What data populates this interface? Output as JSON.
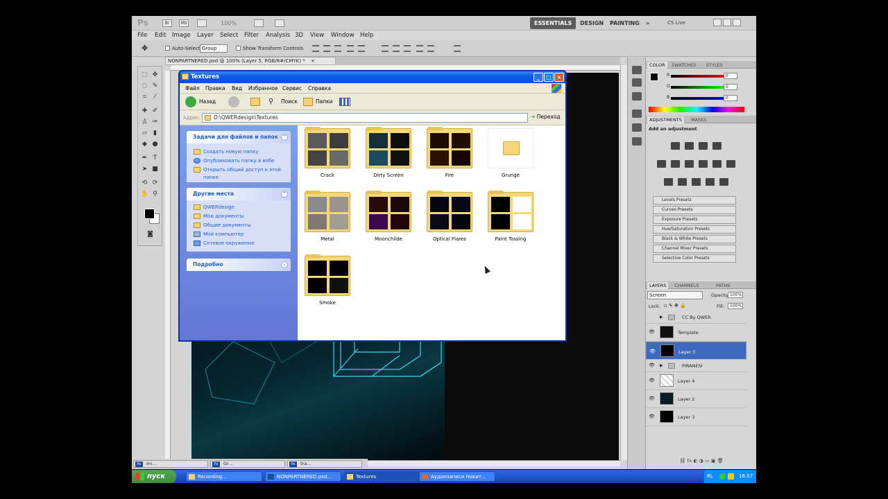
{
  "photoshop": {
    "logo": "Ps",
    "app_buttons": [
      "Br",
      "Mb"
    ],
    "zoom": "100%",
    "workspaces": [
      "ESSENTIALS",
      "DESIGN",
      "PAINTING"
    ],
    "more_ws": "»",
    "cs_live": "CS Live",
    "menu": [
      "File",
      "Edit",
      "Image",
      "Layer",
      "Select",
      "Filter",
      "Analysis",
      "3D",
      "View",
      "Window",
      "Help"
    ],
    "options": {
      "auto_select": "Auto-Select:",
      "auto_select_value": "Group",
      "show_transform": "Show Transform Controls"
    },
    "doc_tab": "NONPARTNERED.psd @ 100% (Layer 5, RGB/8#/CMYK) *",
    "doc_tab_close": "×",
    "bottom_tabs": [
      {
        "label": "Im...",
        "ps": "Ps"
      },
      {
        "label": "Gr...",
        "ps": "Ps"
      },
      {
        "label": "tra...",
        "ps": "Ps"
      }
    ],
    "color_panel": {
      "tabs": [
        "COLOR",
        "SWATCHES",
        "STYLES"
      ],
      "r_label": "R",
      "g_label": "G",
      "b_label": "B",
      "r": "0",
      "g": "0",
      "b": "0"
    },
    "adjustments_panel": {
      "tabs": [
        "ADJUSTMENTS",
        "MASKS"
      ],
      "heading": "Add an adjustment",
      "presets": [
        "Levels Presets",
        "Curves Presets",
        "Exposure Presets",
        "Hue/Saturation Presets",
        "Black & White Presets",
        "Channel Mixer Presets",
        "Selective Color Presets"
      ]
    },
    "layers_panel": {
      "tabs": [
        "LAYERS",
        "CHANNELS",
        "PATHS"
      ],
      "blend_mode": "Screen",
      "opacity_label": "Opacity:",
      "opacity": "100%",
      "lock_label": "Lock:",
      "fill_label": "Fill:",
      "fill": "100%",
      "layers": [
        {
          "name": "CC By QWER",
          "type": "group",
          "visible": false
        },
        {
          "name": "Template",
          "type": "layer",
          "visible": true
        },
        {
          "name": "Layer 5",
          "type": "layer",
          "visible": true,
          "selected": true
        },
        {
          "name": "PIRANESI",
          "type": "group",
          "visible": true
        },
        {
          "name": "Layer 4",
          "type": "layer",
          "visible": true
        },
        {
          "name": "Layer 2",
          "type": "layer",
          "visible": true
        },
        {
          "name": "Layer 3",
          "type": "layer",
          "visible": true
        }
      ]
    }
  },
  "explorer": {
    "title": "Textures",
    "menu": [
      "Файл",
      "Правка",
      "Вид",
      "Избранное",
      "Сервис",
      "Справка"
    ],
    "toolbar": {
      "back": "Назад",
      "search": "Поиск",
      "folders": "Папки"
    },
    "address_label": "Адрес:",
    "address": "D:\\QWERdesign\\Textures",
    "go": "Переход",
    "tasks": {
      "title": "Задачи для файлов и папок",
      "items": [
        "Создать новую папку",
        "Опубликовать папку в вебе",
        "Открыть общий доступ к этой папке"
      ]
    },
    "other_places": {
      "title": "Другие места",
      "items": [
        "QWERdesign",
        "Мои документы",
        "Общие документы",
        "Мой компьютер",
        "Сетевое окружение"
      ]
    },
    "details": {
      "title": "Подробно"
    },
    "folders": [
      "Crack",
      "Dirty Screen",
      "Fire",
      "Grunge",
      "Metal",
      "Moonchilde",
      "Optical Flares",
      "Paint Tossing",
      "Smoke"
    ]
  },
  "taskbar": {
    "start": "пуск",
    "tasks": [
      "Recording...",
      "NONPARTNERED.psd...",
      "Textures",
      "Аудиозаписи Никит..."
    ],
    "lang": "RL",
    "clock": "16:57"
  }
}
